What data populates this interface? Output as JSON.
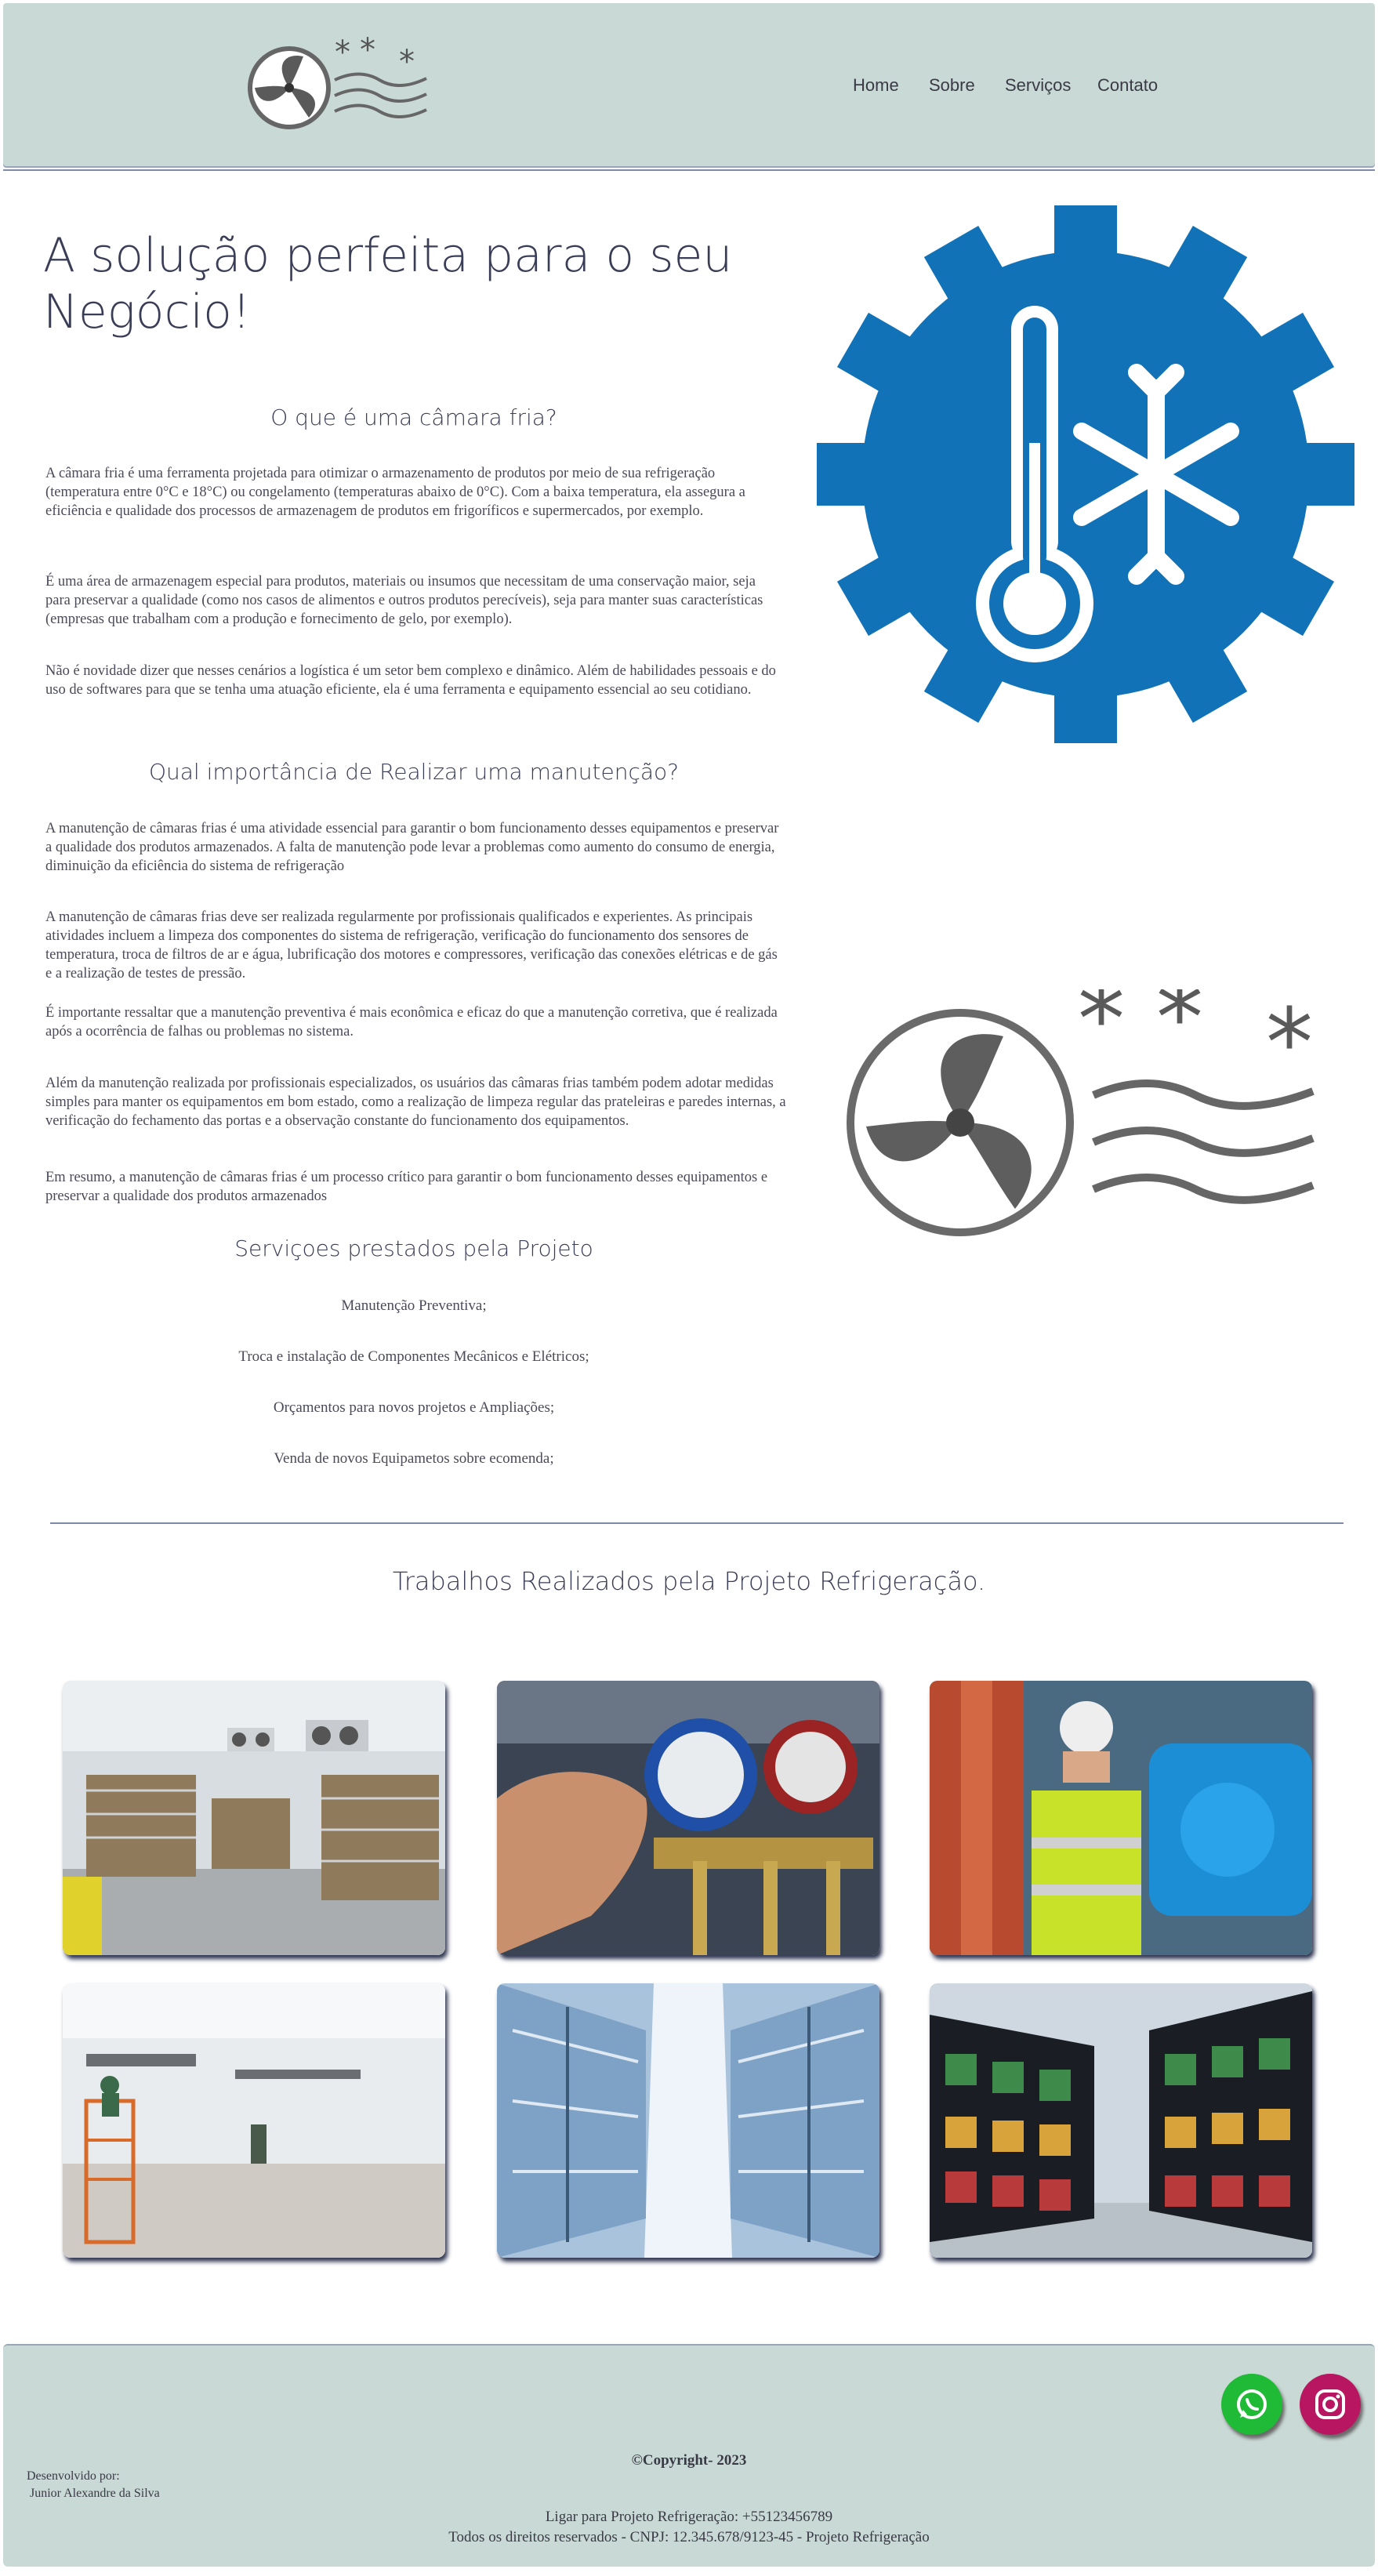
{
  "header": {
    "logo_name": "fan-snowflake-logo",
    "nav": [
      "Home",
      "Sobre",
      "Serviços",
      "Contato"
    ]
  },
  "hero": {
    "title_line1": "A solução perfeita para o seu",
    "title_line2": "Negócio!",
    "q1": "O que é uma câmara fria?",
    "p1": "A câmara fria é uma ferramenta projetada para otimizar o armazenamento de produtos por meio de sua refrigeração (temperatura entre 0°C e 18°C) ou congelamento (temperaturas abaixo de 0°C). Com a baixa temperatura, ela assegura a eficiência e qualidade dos processos de armazenagem de produtos em frigoríficos e supermercados, por exemplo.",
    "p2": "É uma área de armazenagem especial para produtos, materiais ou insumos que necessitam de uma conservação maior, seja para preservar a qualidade (como nos casos de alimentos e outros produtos perecíveis), seja para manter suas características (empresas que trabalham com a produção e fornecimento de gelo, por exemplo).",
    "p3": "Não é novidade dizer que nesses cenários a logística é um setor bem complexo e dinâmico. Além de habilidades pessoais e do uso de softwares para que se tenha uma atuação eficiente, ela é uma ferramenta e equipamento essencial ao seu cotidiano.",
    "q2": "Qual importância de Realizar uma manutenção?",
    "p4": "A manutenção de câmaras frias é uma atividade essencial para garantir o bom funcionamento desses equipamentos e preservar a qualidade dos produtos armazenados. A falta de manutenção pode levar a problemas como aumento do consumo de energia, diminuição da eficiência do sistema de refrigeração",
    "p5": "A manutenção de câmaras frias deve ser realizada regularmente por profissionais qualificados e experientes. As principais atividades incluem a limpeza dos componentes do sistema de refrigeração, verificação do funcionamento dos sensores de temperatura, troca de filtros de ar e água, lubrificação dos motores e compressores, verificação das conexões elétricas e de gás e a realização de testes de pressão.",
    "p6": "É importante ressaltar que a manutenção preventiva é mais econômica e eficaz do que a manutenção corretiva, que é realizada após a ocorrência de falhas ou problemas no sistema.",
    "p7": "Além da manutenção realizada por profissionais especializados, os usuários das câmaras frias também podem adotar medidas simples para manter os equipamentos em bom estado, como a realização de limpeza regular das prateleiras e paredes internas, a verificação do fechamento das portas e a observação constante do funcionamento dos equipamentos.",
    "p8": "Em resumo, a manutenção de câmaras frias é um processo crítico para garantir o bom funcionamento desses equipamentos e preservar a qualidade dos produtos armazenados"
  },
  "services": {
    "title": "Serviçoes prestados pela Projeto",
    "items": [
      "Manutenção Preventiva;",
      "Troca e instalação de Componentes Mecânicos e Elétricos;",
      "Orçamentos para novos projetos e Ampliações;",
      "Venda de novos Equipametos sobre ecomenda;"
    ]
  },
  "gallery": {
    "title": "Trabalhos Realizados pela Projeto Refrigeração."
  },
  "footer": {
    "copyright": "©Copyright- 2023",
    "dev_label": "Desenvolvido por:",
    "dev_name": "Junior Alexandre da Silva",
    "phone": "Ligar para Projeto Refrigeração: +55123456789",
    "rights": "Todos os direitos reservados - CNPJ: 12.345.678/9123-45 - Projeto Refrigeração"
  },
  "colors": {
    "header_bg": "#c9d9d5",
    "thermo_blue": "#1272b8",
    "whatsapp": "#25c33a",
    "instagram": "#c2185b"
  }
}
